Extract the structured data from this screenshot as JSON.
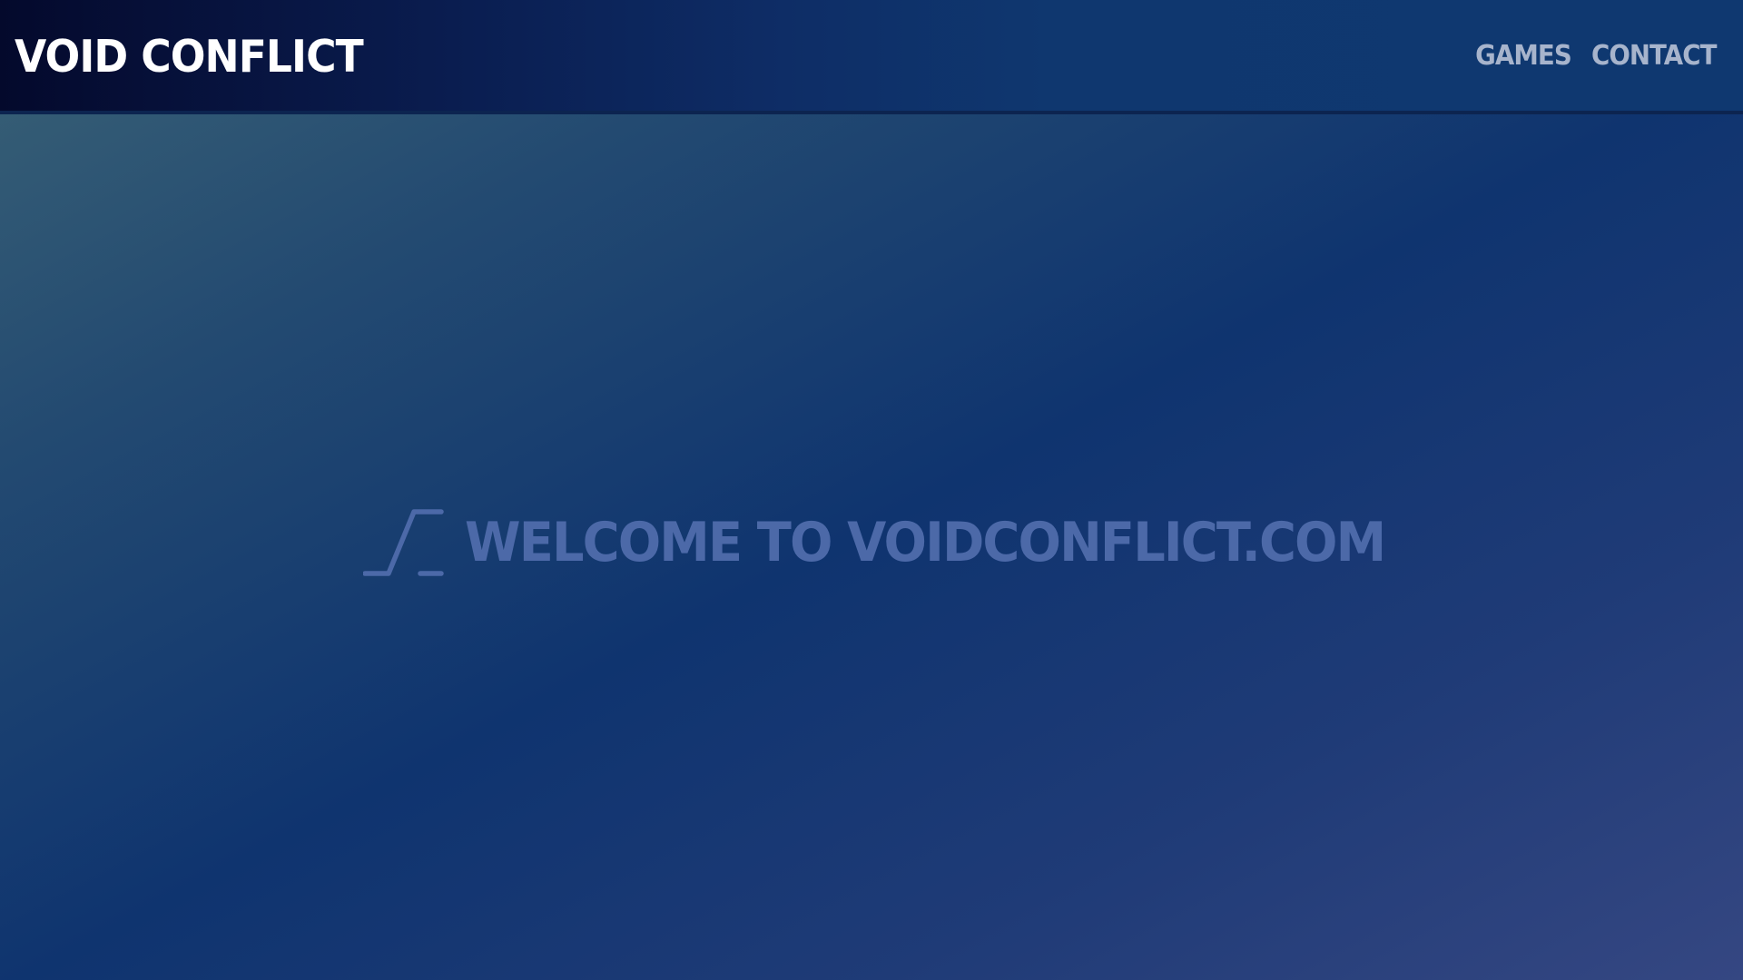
{
  "header": {
    "brand": "VOID CONFLICT",
    "nav": [
      {
        "label": "GAMES"
      },
      {
        "label": "CONTACT"
      }
    ]
  },
  "hero": {
    "icon": "terminal-prompt-icon",
    "text": "WELCOME TO VOIDCONFLICT.COM"
  },
  "colors": {
    "header_dark": "#04092c",
    "header_blue": "#0f3870",
    "brand_text": "#ffffff",
    "nav_text": "#a7b4cc",
    "hero_text": "#4c69a8",
    "background_teal": "#3a6276",
    "background_navy": "#0f346f"
  }
}
